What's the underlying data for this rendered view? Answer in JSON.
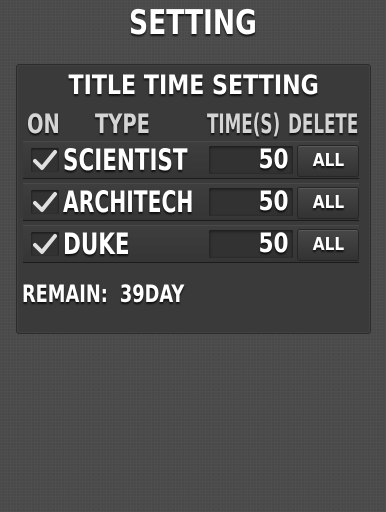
{
  "page": {
    "title": "SETTING"
  },
  "panel": {
    "title": "TITLE TIME SETTING",
    "columns": {
      "on": "ON",
      "type": "TYPE",
      "time": "TIME(S)",
      "delete": "DELETE"
    },
    "rows": [
      {
        "checked": true,
        "name": "SCIENTIST",
        "time": "50",
        "button": "ALL"
      },
      {
        "checked": true,
        "name": "ARCHITECH",
        "time": "50",
        "button": "ALL"
      },
      {
        "checked": true,
        "name": "DUKE",
        "time": "50",
        "button": "ALL"
      }
    ],
    "remain_label": "REMAIN:",
    "remain_value": "39DAY"
  },
  "colors": {
    "background": "#4a4a4a",
    "panel": "#3a3a3a",
    "text": "#ffffff",
    "header_text": "#d4d4d4",
    "check": "#e0e0e0"
  },
  "icons": {
    "check": "check-icon"
  }
}
